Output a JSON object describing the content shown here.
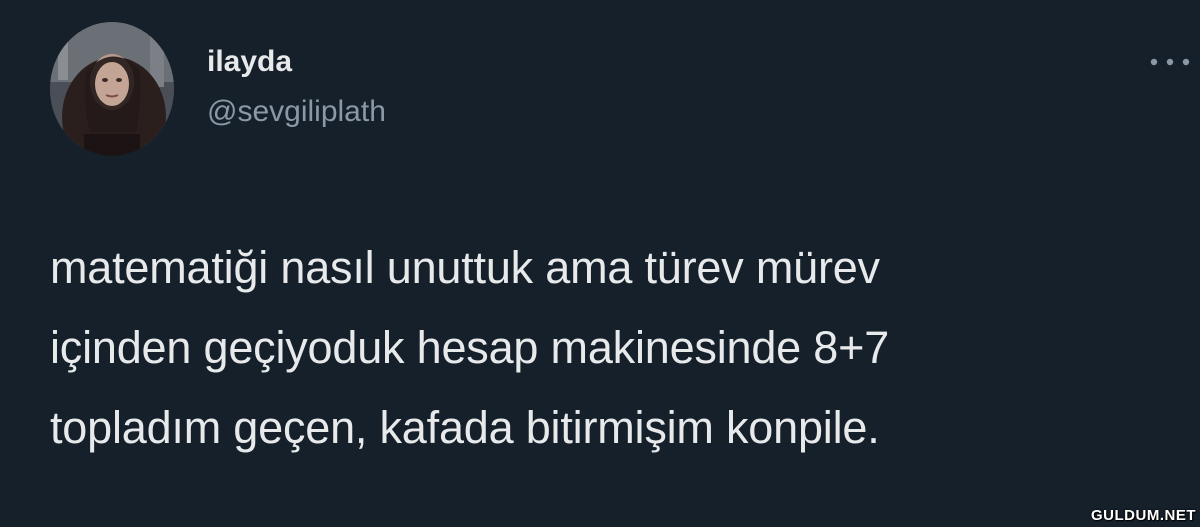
{
  "tweet": {
    "author": {
      "display_name": "ilayda",
      "handle": "@sevgiliplath",
      "avatar_icon": "profile-photo"
    },
    "more_icon": "more-horizontal-icon",
    "text_lines": [
      "matematiği nasıl unuttuk ama türev mürev",
      "içinden geçiyoduk hesap makinesinde 8+7",
      "topladım geçen, kafada bitirmişim konpile."
    ]
  },
  "watermark": "GULDUM.NET",
  "colors": {
    "background": "#15202b",
    "primary_text": "#e7e9ea",
    "secondary_text": "#8b98a5"
  }
}
